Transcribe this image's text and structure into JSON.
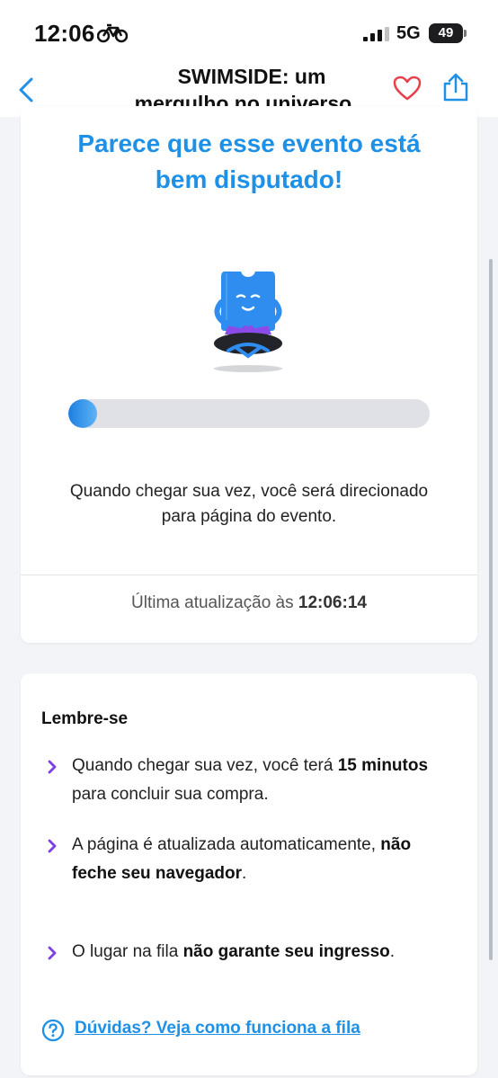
{
  "status_bar": {
    "time": "12:06",
    "network": "5G",
    "battery": "49"
  },
  "header": {
    "title_line1": "SWIMSIDE: um",
    "title_line2": "mergulho no universo..."
  },
  "queue_card": {
    "heading_line1": "Parece que esse evento está",
    "heading_line2": "bem disputado!",
    "progress_fraction": 0.07,
    "redirect_line1": "Quando chegar sua vez, você será direcionado",
    "redirect_line2": "para página do evento.",
    "last_update_label": "Última atualização às",
    "last_update_time": "12:06:14"
  },
  "remember_card": {
    "heading": "Lembre-se",
    "tips": [
      {
        "parts": [
          {
            "text": "Quando chegar sua vez, você terá ",
            "bold": false
          },
          {
            "text": "15 minutos",
            "bold": true
          },
          {
            "text": " para concluir sua compra.",
            "bold": false
          }
        ]
      },
      {
        "parts": [
          {
            "text": "A página é atualizada automaticamente, ",
            "bold": false
          },
          {
            "text": "não feche seu navegador",
            "bold": true
          },
          {
            "text": ".",
            "bold": false
          }
        ]
      },
      {
        "parts": [
          {
            "text": "O lugar na fila ",
            "bold": false
          },
          {
            "text": "não garante seu ingresso",
            "bold": true
          },
          {
            "text": ".",
            "bold": false
          }
        ]
      }
    ],
    "help_link": "Dúvidas? Veja como funciona a fila"
  },
  "colors": {
    "accent_blue": "#1e90e6",
    "chevron_purple": "#7b3fe4",
    "heart_red": "#e8404a"
  },
  "icons": [
    "bicycle-icon",
    "signal-icon",
    "battery-icon",
    "back-icon",
    "heart-icon",
    "share-icon",
    "chevron-right-icon",
    "help-circle-icon"
  ]
}
